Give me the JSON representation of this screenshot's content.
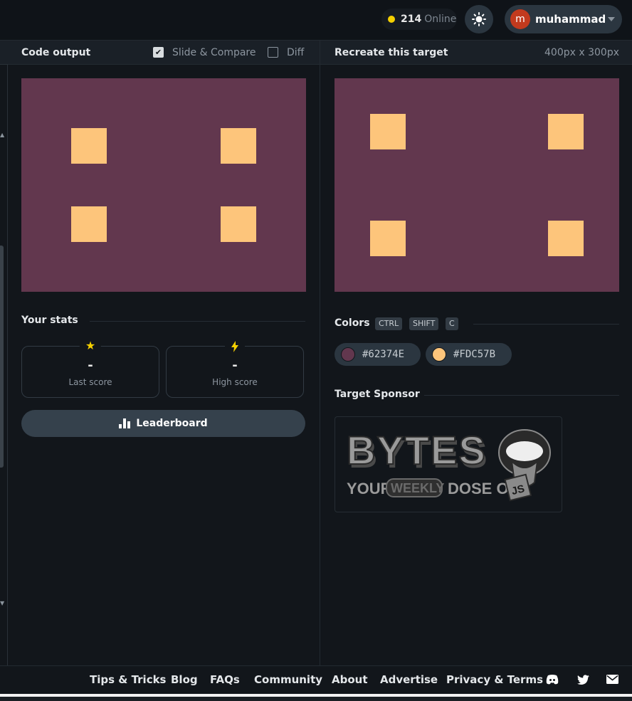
{
  "header": {
    "online_count": "214",
    "online_label": "Online",
    "user_initial": "m",
    "username": "muhammad"
  },
  "left_panel": {
    "title": "Code output",
    "slide_compare_label": "Slide & Compare",
    "slide_compare_checked": true,
    "diff_label": "Diff",
    "diff_checked": false
  },
  "right_panel": {
    "title": "Recreate this target",
    "dimensions": "400px x 300px"
  },
  "stats": {
    "title": "Your stats",
    "last_score_value": "-",
    "last_score_label": "Last score",
    "high_score_value": "-",
    "high_score_label": "High score",
    "leaderboard_label": "Leaderboard"
  },
  "colors": {
    "title": "Colors",
    "shortcut_keys": [
      "CTRL",
      "SHIFT",
      "C"
    ],
    "swatches": [
      {
        "hex": "#62374E"
      },
      {
        "hex": "#FDC57B"
      }
    ]
  },
  "sponsor": {
    "title": "Target Sponsor",
    "logo_text": "BYTES",
    "tagline_your": "YOUR",
    "tagline_weekly": "WEEKLY",
    "tagline_dose": "DOSE OF",
    "tagline_js": "JS"
  },
  "footer": {
    "links": [
      "Tips & Tricks",
      "Blog",
      "FAQs",
      "Community",
      "About",
      "Advertise",
      "Privacy & Terms"
    ]
  },
  "theme_colors": {
    "target_background": "#62374E",
    "target_square": "#FDC57B"
  }
}
